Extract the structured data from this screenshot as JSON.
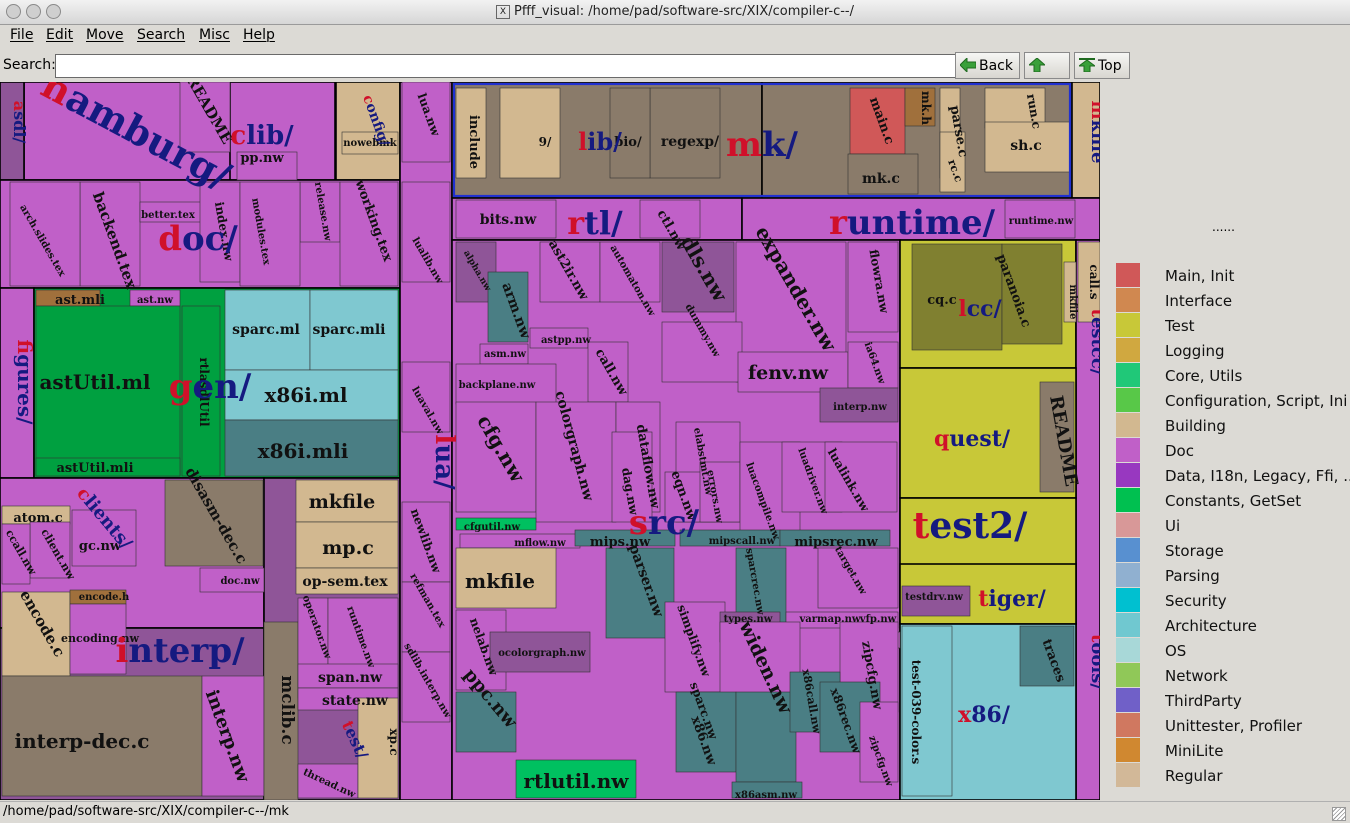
{
  "window": {
    "title": "Pfff_visual: /home/pad/software-src/XIX/compiler-c--/"
  },
  "menu": [
    "File",
    "Edit",
    "Move",
    "Search",
    "Misc",
    "Help"
  ],
  "search": {
    "label": "Search:",
    "value": ""
  },
  "nav": {
    "back": "Back",
    "up": "Up",
    "top": "Top"
  },
  "treemap": {
    "dirs": [
      {
        "label": "hamburg/",
        "color": "#c060c8"
      },
      {
        "label": "asdl/",
        "color": "#8f5598"
      },
      {
        "label": "clib/",
        "color": "#c060c8"
      },
      {
        "label": "config/",
        "color": "#d2b890"
      },
      {
        "label": "doc/",
        "color": "#c060c8"
      },
      {
        "label": "figures/",
        "color": "#c060c8"
      },
      {
        "label": "gen/",
        "color": "#00a040"
      },
      {
        "label": "clients/",
        "color": "#c060c8"
      },
      {
        "label": "interp/",
        "color": "#8f5598"
      },
      {
        "label": "lua/",
        "color": "#c060c8"
      },
      {
        "label": "lib/",
        "color": "#8a7b6a"
      },
      {
        "label": "mk/",
        "color": "#8a7b6a"
      },
      {
        "label": "mkfile",
        "color": "#d2b890"
      },
      {
        "label": "rtl/",
        "color": "#c060c8"
      },
      {
        "label": "runtime/",
        "color": "#c060c8"
      },
      {
        "label": "src/",
        "color": "#c060c8"
      },
      {
        "label": "lcc/",
        "color": "#c8c838"
      },
      {
        "label": "testcc/",
        "color": "#c060c8"
      },
      {
        "label": "quest/",
        "color": "#c8c838"
      },
      {
        "label": "test2/",
        "color": "#c8c838"
      },
      {
        "label": "tiger/",
        "color": "#c8c838"
      },
      {
        "label": "x86/",
        "color": "#7fc8d0"
      },
      {
        "label": "tools/",
        "color": "#c060c8"
      },
      {
        "label": "test/",
        "color": "#8f5598"
      }
    ],
    "files": [
      {
        "label": "README",
        "color": "#c060c8"
      },
      {
        "label": "pp.nw",
        "color": "#c060c8"
      },
      {
        "label": "nowebmk",
        "color": "#d2b890"
      },
      {
        "label": "backend.tex",
        "color": "#c060c8"
      },
      {
        "label": "better.tex",
        "color": "#c060c8"
      },
      {
        "label": "index.nw",
        "color": "#c060c8"
      },
      {
        "label": "release.nw",
        "color": "#c060c8"
      },
      {
        "label": "working.tex",
        "color": "#c060c8"
      },
      {
        "label": "arch.slides.tex",
        "color": "#c060c8"
      },
      {
        "label": "modules.tex",
        "color": "#c060c8"
      },
      {
        "label": "ast.mli",
        "color": "#a0703c"
      },
      {
        "label": "ast.nw",
        "color": "#c060c8"
      },
      {
        "label": "astUtil.ml",
        "color": "#00a040"
      },
      {
        "label": "astUtil.mli",
        "color": "#00a040"
      },
      {
        "label": "rtlasdlUtil",
        "color": "#00a040"
      },
      {
        "label": "sparc.ml",
        "color": "#7fc8d0"
      },
      {
        "label": "sparc.mli",
        "color": "#7fc8d0"
      },
      {
        "label": "x86i.ml",
        "color": "#7fc8d0"
      },
      {
        "label": "x86i.mli",
        "color": "#4a7e84"
      },
      {
        "label": "atom.c",
        "color": "#d2b890"
      },
      {
        "label": "gc.nw",
        "color": "#c060c8"
      },
      {
        "label": "client.nw",
        "color": "#c060c8"
      },
      {
        "label": "ccall.nw",
        "color": "#c060c8"
      },
      {
        "label": "disasm-dec.c",
        "color": "#8a7b6a"
      },
      {
        "label": "mkfile",
        "color": "#d2b890"
      },
      {
        "label": "mp.c",
        "color": "#d2b890"
      },
      {
        "label": "op-sem.tex",
        "color": "#d2b890"
      },
      {
        "label": "doc.nw",
        "color": "#c060c8"
      },
      {
        "label": "encode.c",
        "color": "#d2b890"
      },
      {
        "label": "encode.h",
        "color": "#a0703c"
      },
      {
        "label": "encoding.nw",
        "color": "#c060c8"
      },
      {
        "label": "interp-dec.c",
        "color": "#8a7b6a"
      },
      {
        "label": "interp.nw",
        "color": "#c060c8"
      },
      {
        "label": "mclib.c",
        "color": "#8a7b6a"
      },
      {
        "label": "operator.nw",
        "color": "#c060c8"
      },
      {
        "label": "runtime.nw",
        "color": "#c060c8"
      },
      {
        "label": "span.nw",
        "color": "#c060c8"
      },
      {
        "label": "state.nw",
        "color": "#c060c8"
      },
      {
        "label": "thread.nw",
        "color": "#c060c8"
      },
      {
        "label": "xp.c",
        "color": "#d2b890"
      },
      {
        "label": "lua.nw",
        "color": "#c060c8"
      },
      {
        "label": "lualib.nw",
        "color": "#c060c8"
      },
      {
        "label": "luaval.nw",
        "color": "#c060c8"
      },
      {
        "label": "newlib.nw",
        "color": "#c060c8"
      },
      {
        "label": "refman.tex",
        "color": "#c060c8"
      },
      {
        "label": "sdlib.interp.nw",
        "color": "#c060c8"
      },
      {
        "label": "include",
        "color": "#d2b890"
      },
      {
        "label": "regexp/",
        "color": "#8a7b6a"
      },
      {
        "label": "bio/",
        "color": "#8a7b6a"
      },
      {
        "label": "9/",
        "color": "#d2b890"
      },
      {
        "label": "main.c",
        "color": "#d05858"
      },
      {
        "label": "mk.h",
        "color": "#a0703c"
      },
      {
        "label": "parse.c",
        "color": "#d2b890"
      },
      {
        "label": "run.c",
        "color": "#d2b890"
      },
      {
        "label": "sh.c",
        "color": "#d2b890"
      },
      {
        "label": "mk.c",
        "color": "#8a7b6a"
      },
      {
        "label": "rc.c",
        "color": "#d2b890"
      },
      {
        "label": "bits.nw",
        "color": "#c060c8"
      },
      {
        "label": "ctl.nw",
        "color": "#c060c8"
      },
      {
        "label": "runtime.nw",
        "color": "#c060c8"
      },
      {
        "label": "alpha.nw",
        "color": "#8f5598"
      },
      {
        "label": "ast2ir.nw",
        "color": "#c060c8"
      },
      {
        "label": "automaton.nw",
        "color": "#c060c8"
      },
      {
        "label": "dls.nw",
        "color": "#8f5598"
      },
      {
        "label": "expander.nw",
        "color": "#c060c8"
      },
      {
        "label": "flowra.nw",
        "color": "#c060c8"
      },
      {
        "label": "arm.nw",
        "color": "#4a7e84"
      },
      {
        "label": "asm.nw",
        "color": "#c060c8"
      },
      {
        "label": "astpp.nw",
        "color": "#c060c8"
      },
      {
        "label": "call.nw",
        "color": "#c060c8"
      },
      {
        "label": "dummy.nw",
        "color": "#c060c8"
      },
      {
        "label": "backplane.nw",
        "color": "#c060c8"
      },
      {
        "label": "fenv.nw",
        "color": "#c060c8"
      },
      {
        "label": "ia64.nw",
        "color": "#c060c8"
      },
      {
        "label": "interp.nw",
        "color": "#8f5598"
      },
      {
        "label": "cfg.nw",
        "color": "#c060c8"
      },
      {
        "label": "colorgraph.nw",
        "color": "#c060c8"
      },
      {
        "label": "dataflow.nw",
        "color": "#c060c8"
      },
      {
        "label": "dag.nw",
        "color": "#c060c8"
      },
      {
        "label": "elabstmt.nw",
        "color": "#c060c8"
      },
      {
        "label": "eqn.nw",
        "color": "#c060c8"
      },
      {
        "label": "errors.nw",
        "color": "#c060c8"
      },
      {
        "label": "luacompile.nw",
        "color": "#c060c8"
      },
      {
        "label": "luadriver.nw",
        "color": "#c060c8"
      },
      {
        "label": "lualink.nw",
        "color": "#c060c8"
      },
      {
        "label": "cfgutil.nw",
        "color": "#00c060"
      },
      {
        "label": "mflow.nw",
        "color": "#c060c8"
      },
      {
        "label": "mips.nw",
        "color": "#4a7e84"
      },
      {
        "label": "mipscall.nw",
        "color": "#4a7e84"
      },
      {
        "label": "mipsrec.nw",
        "color": "#4a7e84"
      },
      {
        "label": "mkfile",
        "color": "#d2b890"
      },
      {
        "label": "parser.nw",
        "color": "#4a7e84"
      },
      {
        "label": "sparcrec.nw",
        "color": "#4a7e84"
      },
      {
        "label": "target.nw",
        "color": "#c060c8"
      },
      {
        "label": "nelab.nw",
        "color": "#c060c8"
      },
      {
        "label": "ocolorgraph.nw",
        "color": "#8f5598"
      },
      {
        "label": "simplify.nw",
        "color": "#c060c8"
      },
      {
        "label": "types.nw",
        "color": "#8f5598"
      },
      {
        "label": "varmap.nw",
        "color": "#c060c8"
      },
      {
        "label": "vfp.nw",
        "color": "#c060c8"
      },
      {
        "label": "widen.nw",
        "color": "#c060c8"
      },
      {
        "label": "zipcfg.nw",
        "color": "#c060c8"
      },
      {
        "label": "ppc.nw",
        "color": "#4a7e84"
      },
      {
        "label": "rtlutil.nw",
        "color": "#00c060"
      },
      {
        "label": "sparc.nw",
        "color": "#4a7e84"
      },
      {
        "label": "x86.nw",
        "color": "#4a7e84"
      },
      {
        "label": "x86call.nw",
        "color": "#4a7e84"
      },
      {
        "label": "x86rec.nw",
        "color": "#4a7e84"
      },
      {
        "label": "zipcfg.nw",
        "color": "#c060c8"
      },
      {
        "label": "x86asm.nw",
        "color": "#4a7e84"
      },
      {
        "label": "cq.c",
        "color": "#808030"
      },
      {
        "label": "paranoia.c",
        "color": "#808030"
      },
      {
        "label": "README",
        "color": "#8a7b6a"
      },
      {
        "label": "mkfile",
        "color": "#d2b890"
      },
      {
        "label": "testdrv.nw",
        "color": "#8f5598"
      },
      {
        "label": "test-039-color.s",
        "color": "#7fc8d0"
      },
      {
        "label": "traces",
        "color": "#4a7e84"
      },
      {
        "label": "call.s",
        "color": "#d2b890"
      }
    ]
  },
  "legend": [
    {
      "label": "Main, Init",
      "color": "#d05858"
    },
    {
      "label": "Interface",
      "color": "#d08850"
    },
    {
      "label": "Test",
      "color": "#c8c838"
    },
    {
      "label": "Logging",
      "color": "#d0a840"
    },
    {
      "label": "Core, Utils",
      "color": "#20c878"
    },
    {
      "label": "Configuration, Script, Ini",
      "color": "#58c848"
    },
    {
      "label": "Building",
      "color": "#d2b890"
    },
    {
      "label": "Doc",
      "color": "#c060c8"
    },
    {
      "label": "Data, I18n, Legacy, Ffi, ...",
      "color": "#9838c0"
    },
    {
      "label": "Constants, GetSet",
      "color": "#00c050"
    },
    {
      "label": "Ui",
      "color": "#d89898"
    },
    {
      "label": "Storage",
      "color": "#5890d0"
    },
    {
      "label": "Parsing",
      "color": "#90b0d0"
    },
    {
      "label": "Security",
      "color": "#00c0d0"
    },
    {
      "label": "Architecture",
      "color": "#70c8d0"
    },
    {
      "label": "OS",
      "color": "#a8d8d8"
    },
    {
      "label": "Network",
      "color": "#90c858"
    },
    {
      "label": "ThirdParty",
      "color": "#7060c8"
    },
    {
      "label": "Unittester, Profiler",
      "color": "#d07860"
    },
    {
      "label": "MiniLite",
      "color": "#d08830"
    },
    {
      "label": "Regular",
      "color": "#d2b898"
    }
  ],
  "legend_header": "......",
  "status": {
    "path": "/home/pad/software-src/XIX/compiler-c--/mk"
  }
}
